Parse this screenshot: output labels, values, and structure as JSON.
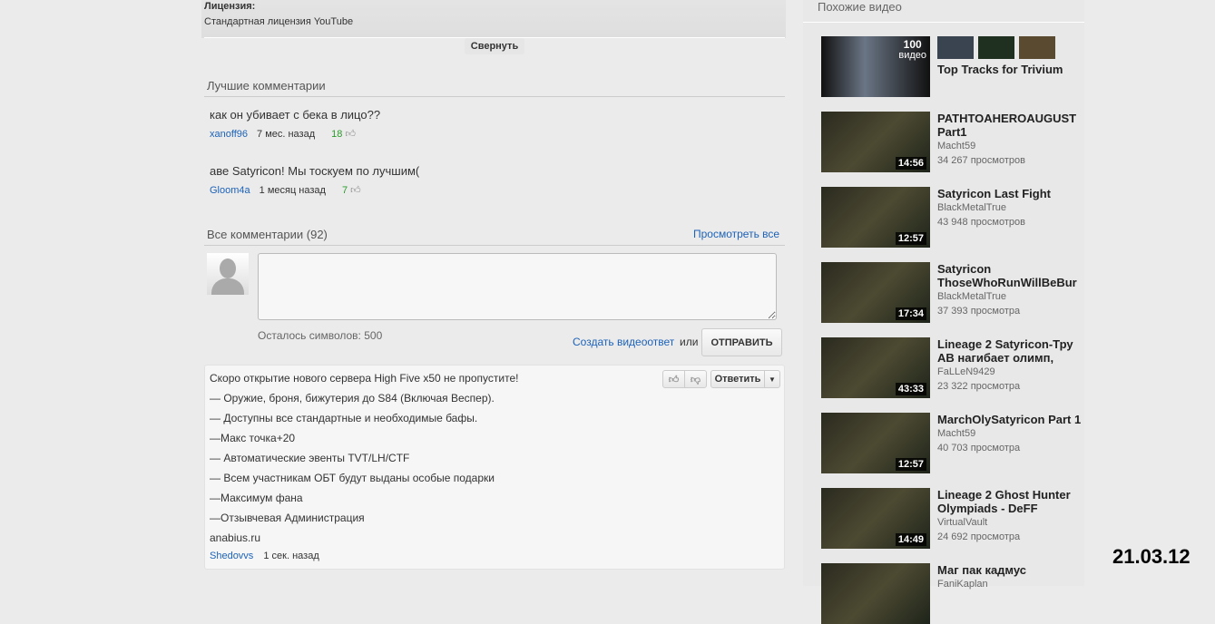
{
  "license": {
    "label": "Лицензия:",
    "value": "Стандартная лицензия YouTube",
    "collapse": "Свернуть"
  },
  "top_comments": {
    "title": "Лучшие комментарии",
    "items": [
      {
        "text": "как он убивает с бека в лицо??",
        "author": "xanoff96",
        "time": "7 мес. назад",
        "likes": "18"
      },
      {
        "text": "аве Satyricon! Мы тоскуем по лучшим(",
        "author": "Gloom4a",
        "time": "1 месяц назад",
        "likes": "7"
      }
    ]
  },
  "all_comments": {
    "title": "Все комментарии (92)",
    "view_all": "Просмотреть все",
    "chars_left": "Осталось символов: 500",
    "video_reply": "Создать видеоответ",
    "or": "или",
    "send": "ОТПРАВИТЬ",
    "textarea_value": ""
  },
  "comment": {
    "lines": [
      "Скоро открытие нового сервера High Five x50 не пропустите!",
      "— Оружие, броня, бижутерия до S84 (Включая Веспер).",
      "— Доступны все стандартные и необходимые бафы.",
      "—Макс точка+20",
      "— Автоматические эвенты TVT/LH/CTF",
      "— Всем участникам ОБТ будут выданы особые подарки",
      "—Максимум фана",
      "—Отзывчевая Администрация",
      "anabius.ru"
    ],
    "author": "Shedovvs",
    "time": "1 сек. назад",
    "reply": "Ответить"
  },
  "related": {
    "title": "Похожие видео",
    "playlist": {
      "count": "100",
      "count_label": "видео",
      "title": "Top Tracks for Trivium"
    },
    "videos": [
      {
        "title": "PATHTOAHEROAUGUST Part1",
        "channel": "Macht59",
        "views": "34 267 просмотров",
        "duration": "14:56"
      },
      {
        "title": "Satyricon Last Fight",
        "channel": "BlackMetalTrue",
        "views": "43 948 просмотров",
        "duration": "12:57"
      },
      {
        "title": "Satyricon ThoseWhoRunWillBeBur",
        "channel": "BlackMetalTrue",
        "views": "37 393 просмотра",
        "duration": "17:34"
      },
      {
        "title": "Lineage 2 Satyricon-Тру АВ нагибает олимп,",
        "channel": "FaLLeN9429",
        "views": "23 322 просмотра",
        "duration": "43:33"
      },
      {
        "title": "MarchOlySatyricon Part 1",
        "channel": "Macht59",
        "views": "40 703 просмотра",
        "duration": "12:57"
      },
      {
        "title": "Lineage 2 Ghost Hunter Olympiads - DeFF",
        "channel": "VirtualVault",
        "views": "24 692 просмотра",
        "duration": "14:49"
      },
      {
        "title": "Маг пак кадмус",
        "channel": "FaniKaplan",
        "views": "",
        "duration": ""
      }
    ]
  },
  "date_stamp": "21.03.12"
}
